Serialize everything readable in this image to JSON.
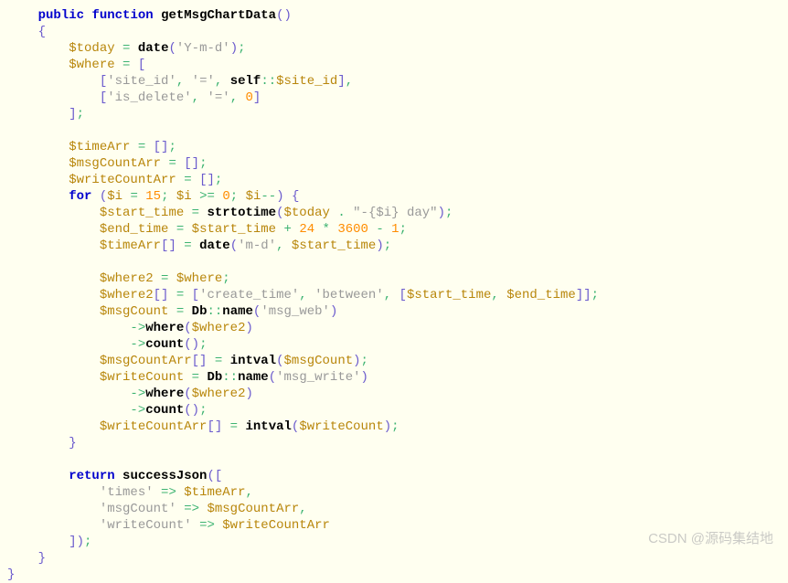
{
  "watermark": "CSDN @源码集结地",
  "code": {
    "func_decl": {
      "public": "public",
      "function": "function",
      "name": "getMsgChartData"
    },
    "l1": {
      "var": "$today",
      "fn": "date",
      "arg": "'Y-m-d'"
    },
    "l2": {
      "var": "$where"
    },
    "l3": {
      "s1": "'site_id'",
      "s2": "'='",
      "self": "self",
      "prop": "$site_id"
    },
    "l4": {
      "s1": "'is_delete'",
      "s2": "'='",
      "val": "0"
    },
    "l5": {
      "var": "$timeArr"
    },
    "l6": {
      "var": "$msgCountArr"
    },
    "l7": {
      "var": "$writeCountArr"
    },
    "for": {
      "kw": "for",
      "var": "$i",
      "init": "15",
      "cond": "0"
    },
    "f1": {
      "var": "$start_time",
      "fn": "strtotime",
      "v1": "$today",
      "str": "\"-{$i} day\""
    },
    "f2": {
      "var": "$end_time",
      "v1": "$start_time",
      "n1": "24",
      "n2": "3600",
      "n3": "1"
    },
    "f3": {
      "var": "$timeArr",
      "fn": "date",
      "s1": "'m-d'",
      "v1": "$start_time"
    },
    "f4": {
      "var": "$where2",
      "v1": "$where"
    },
    "f5": {
      "var": "$where2",
      "s1": "'create_time'",
      "s2": "'between'",
      "v1": "$start_time",
      "v2": "$end_time"
    },
    "f6": {
      "var": "$msgCount",
      "cls": "Db",
      "fn": "name",
      "s1": "'msg_web'"
    },
    "f7": {
      "fn": "where",
      "v1": "$where2"
    },
    "f8": {
      "fn": "count"
    },
    "f9": {
      "var": "$msgCountArr",
      "fn": "intval",
      "v1": "$msgCount"
    },
    "f10": {
      "var": "$writeCount",
      "cls": "Db",
      "fn": "name",
      "s1": "'msg_write'"
    },
    "f11": {
      "fn": "where",
      "v1": "$where2"
    },
    "f12": {
      "fn": "count"
    },
    "f13": {
      "var": "$writeCountArr",
      "fn": "intval",
      "v1": "$writeCount"
    },
    "ret": {
      "kw": "return",
      "fn": "successJson"
    },
    "r1": {
      "key": "'times'",
      "val": "$timeArr"
    },
    "r2": {
      "key": "'msgCount'",
      "val": "$msgCountArr"
    },
    "r3": {
      "key": "'writeCount'",
      "val": "$writeCountArr"
    }
  }
}
